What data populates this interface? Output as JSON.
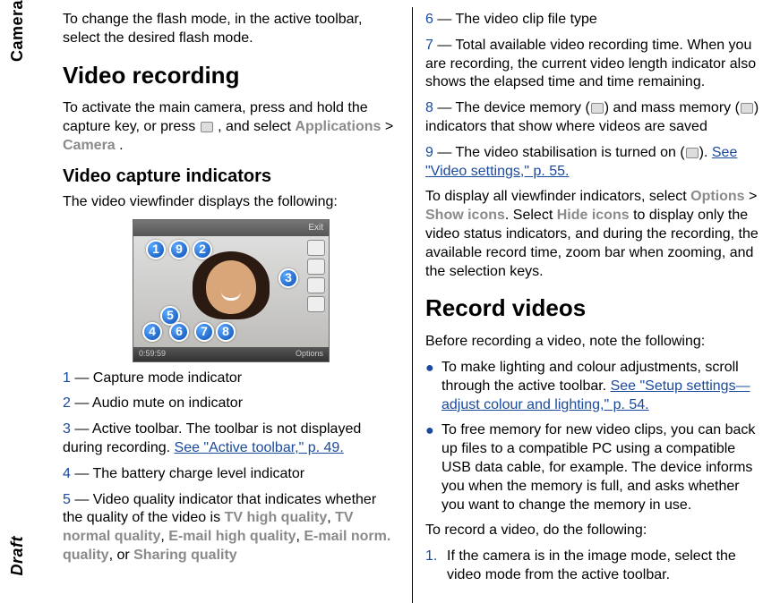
{
  "side": {
    "top": "Camera",
    "bottom": "Draft"
  },
  "left": {
    "flash_para": "To change the flash mode, in the active toolbar, select the desired flash mode.",
    "h1_video_recording": "Video recording",
    "activate_para_1": "To activate the main camera, press and hold the capture key, or press ",
    "activate_para_2": ", and select ",
    "app_label": "Applications",
    "gt": " > ",
    "camera_label": "Camera",
    "period": ".",
    "h2_indicators": "Video capture indicators",
    "viewfinder_intro": "The video viewfinder displays the following:",
    "img": {
      "exit": "Exit",
      "time": "0:59:59",
      "options": "Options",
      "balloons": {
        "1": "1",
        "2": "2",
        "3": "3",
        "4": "4",
        "5": "5",
        "6": "6",
        "7": "7",
        "8": "8",
        "9": "9"
      }
    },
    "ind1_num": "1",
    "ind1_txt": " — Capture mode indicator",
    "ind2_num": "2",
    "ind2_txt": " — Audio mute on indicator",
    "ind3_num": "3",
    "ind3_txt_a": " — Active toolbar. The toolbar is not displayed during recording. ",
    "ind3_link": "See \"Active toolbar,\" p. 49.",
    "ind4_num": "4",
    "ind4_txt": " — The battery charge level indicator",
    "ind5_num": "5",
    "ind5_txt_a": " — Video quality indicator that indicates whether the quality of the video is ",
    "ind5_q1": "TV high quality",
    "comma": ", ",
    "ind5_q2": "TV normal quality",
    "ind5_q3": "E-mail high quality",
    "ind5_q4": "E-mail norm. quality",
    "or": ", or ",
    "ind5_q5": "Sharing quality"
  },
  "right": {
    "ind6_num": "6",
    "ind6_txt": " — The video clip file type",
    "ind7_num": "7",
    "ind7_txt": " — Total available video recording time. When you are recording, the current video length indicator also shows the elapsed time and time remaining.",
    "ind8_num": "8",
    "ind8_txt_a": " — The device memory (",
    "ind8_txt_b": ") and mass memory (",
    "ind8_txt_c": ") indicators that show where videos are saved",
    "ind9_num": "9",
    "ind9_txt_a": " — The video stabilisation is turned on (",
    "ind9_txt_b": "). ",
    "ind9_link": "See \"Video settings,\" p. 55.",
    "display_all_a": "To display all viewfinder indicators, select ",
    "options_lbl": "Options",
    "gt": " > ",
    "show_icons": "Show icons",
    "display_all_b": ". Select ",
    "hide_icons": "Hide icons",
    "display_all_c": " to display only the video status indicators, and during the recording, the available record time, zoom bar when zooming, and the selection keys.",
    "h1_record": "Record videos",
    "before_intro": "Before recording a video, note the following:",
    "bullet1_a": "To make lighting and colour adjustments, scroll through the active toolbar. ",
    "bullet1_link": "See \"Setup settings—adjust colour and lighting,\" p. 54.",
    "bullet2": "To free memory for new video clips, you can back up files to a compatible PC using a compatible USB data cable, for example. The device informs you when the memory is full, and asks whether you want to change the memory in use.",
    "to_record": "To record a video, do the following:",
    "step1_num": "1.",
    "step1_txt": "If the camera is in the image mode, select the video mode from the active toolbar."
  }
}
